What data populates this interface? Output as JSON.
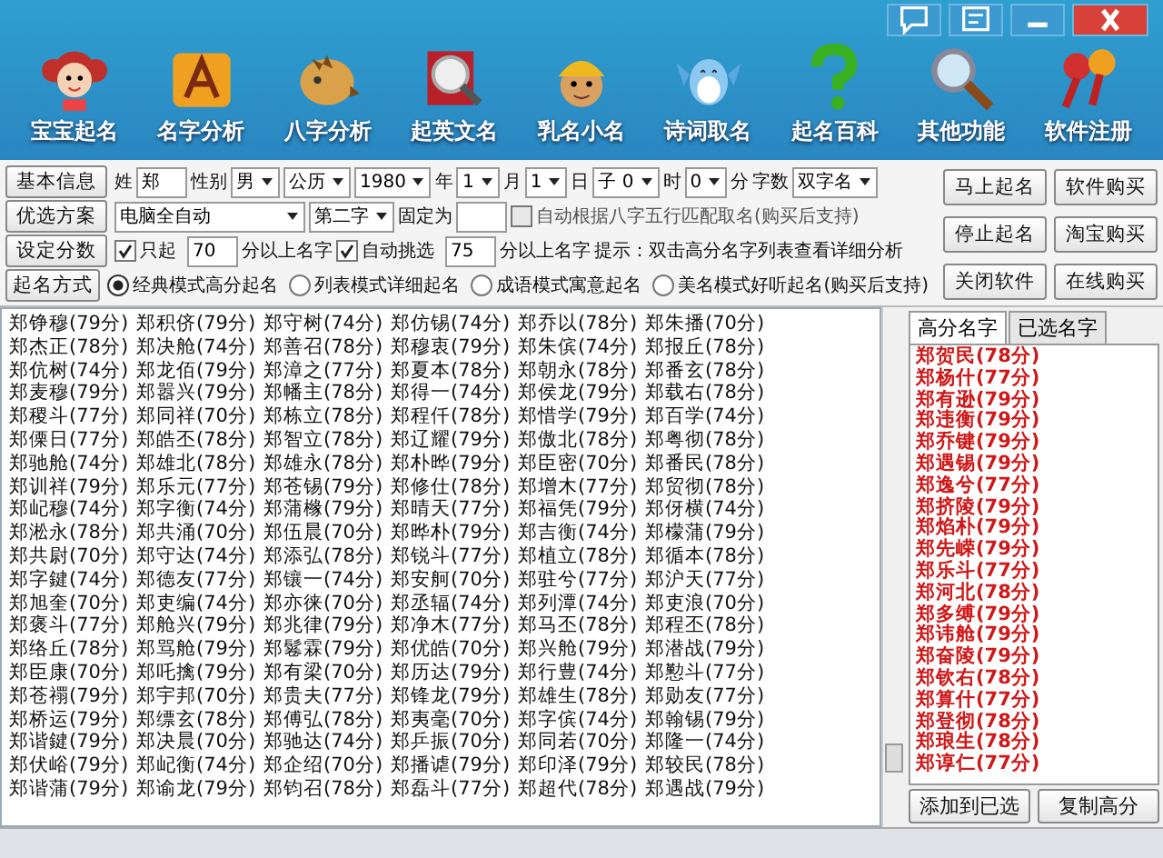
{
  "toolbar": [
    {
      "label": "宝宝起名"
    },
    {
      "label": "名字分析"
    },
    {
      "label": "八字分析"
    },
    {
      "label": "起英文名"
    },
    {
      "label": "乳名小名"
    },
    {
      "label": "诗词取名"
    },
    {
      "label": "起名百科"
    },
    {
      "label": "其他功能"
    },
    {
      "label": "软件注册"
    }
  ],
  "form_rows": [
    [
      {
        "kind": "button",
        "text": "基本信息"
      },
      {
        "kind": "label",
        "text": "姓"
      },
      {
        "kind": "input",
        "value": "郑"
      },
      {
        "kind": "label",
        "text": "性别"
      },
      {
        "kind": "select",
        "value": "男"
      },
      {
        "kind": "select",
        "value": "公历"
      },
      {
        "kind": "select",
        "value": "1980"
      },
      {
        "kind": "label",
        "text": "年"
      },
      {
        "kind": "select",
        "value": "1"
      },
      {
        "kind": "label",
        "text": "月"
      },
      {
        "kind": "select",
        "value": "1"
      },
      {
        "kind": "label",
        "text": "日"
      },
      {
        "kind": "select",
        "value": "子 0"
      },
      {
        "kind": "label",
        "text": "时"
      },
      {
        "kind": "select",
        "value": "0"
      },
      {
        "kind": "label",
        "text": "分"
      },
      {
        "kind": "label",
        "text": "字数"
      },
      {
        "kind": "select",
        "value": "双字名"
      }
    ],
    [
      {
        "kind": "button",
        "text": "优选方案"
      },
      {
        "kind": "select",
        "value": "电脑全自动"
      },
      {
        "kind": "select",
        "value": "第二字"
      },
      {
        "kind": "label",
        "text": "固定为"
      },
      {
        "kind": "input"
      },
      {
        "kind": "checkbox",
        "text": "自动根据八字五行匹配取名(购买后支持)",
        "checked": false,
        "disabled": true
      }
    ],
    [
      {
        "kind": "button",
        "text": "设定分数"
      },
      {
        "kind": "checkbox",
        "text": "只起",
        "checked": true,
        "disabled": false
      },
      {
        "kind": "input",
        "value": "70"
      },
      {
        "kind": "label",
        "text": "分以上名字"
      },
      {
        "kind": "checkbox",
        "text": "自动挑选",
        "checked": true,
        "disabled": false
      },
      {
        "kind": "input",
        "value": "75"
      },
      {
        "kind": "label",
        "text": "分以上名字"
      },
      {
        "kind": "label",
        "text": "提示：双击高分名字列表查看详细分析"
      }
    ],
    [
      {
        "kind": "button",
        "text": "起名方式"
      },
      {
        "kind": "radio",
        "text": "经典模式高分起名",
        "selected": true
      },
      {
        "kind": "radio",
        "text": "列表模式详细起名",
        "selected": false
      },
      {
        "kind": "radio",
        "text": "成语模式寓意起名",
        "selected": false
      },
      {
        "kind": "radio",
        "text": "美名模式好听起名(购买后支持)",
        "selected": false
      }
    ]
  ],
  "side_buttons": [
    "马上起名",
    "软件购买",
    "停止起名",
    "淘宝购买",
    "关闭软件",
    "在线购买"
  ],
  "name_columns": [
    [
      "郑铮穆(79分)",
      "郑杰正(78分)",
      "郑伉树(74分)",
      "郑麦穆(79分)",
      "郑稷斗(77分)",
      "郑傈日(77分)",
      "郑驰舱(74分)",
      "郑训祥(79分)",
      "郑屺穆(74分)",
      "郑淞永(78分)",
      "郑共尉(70分)",
      "郑字鍵(74分)",
      "郑旭奎(70分)",
      "郑褒斗(77分)",
      "郑络丘(78分)",
      "郑臣康(70分)",
      "郑苍禤(79分)",
      "郑桥运(79分)",
      "郑谐鍵(79分)",
      "郑伏峪(79分)",
      "郑谐蒲(79分)"
    ],
    [
      "郑积侪(79分)",
      "郑决舱(74分)",
      "郑龙佰(79分)",
      "郑嚣兴(79分)",
      "郑同祥(70分)",
      "郑皓丕(78分)",
      "郑雄北(78分)",
      "郑乐元(77分)",
      "郑字衡(74分)",
      "郑共涌(70分)",
      "郑守达(74分)",
      "郑德友(77分)",
      "郑吏编(74分)",
      "郑舱兴(79分)",
      "郑骂舱(79分)",
      "郑吒擒(79分)",
      "郑宇邦(70分)",
      "郑缥玄(78分)",
      "郑决晨(70分)",
      "郑屺衡(74分)",
      "郑谕龙(79分)"
    ],
    [
      "郑守树(74分)",
      "郑善召(78分)",
      "郑漳之(77分)",
      "郑幡主(78分)",
      "郑栋立(78分)",
      "郑智立(78分)",
      "郑雄永(78分)",
      "郑苍锡(79分)",
      "郑蒲橼(79分)",
      "郑伍晨(70分)",
      "郑添弘(78分)",
      "郑镶一(74分)",
      "郑亦徕(70分)",
      "郑兆律(79分)",
      "郑鬈霖(79分)",
      "郑有梁(70分)",
      "郑贵夫(77分)",
      "郑傅弘(78分)",
      "郑驰达(74分)",
      "郑企绍(70分)",
      "郑钧召(78分)"
    ],
    [
      "郑仿锡(74分)",
      "郑穆衷(79分)",
      "郑夏本(78分)",
      "郑得一(74分)",
      "郑程仟(78分)",
      "郑辽耀(79分)",
      "郑朴晔(79分)",
      "郑修仕(78分)",
      "郑晴天(77分)",
      "郑晔朴(79分)",
      "郑锐斗(77分)",
      "郑安舸(70分)",
      "郑丞辐(74分)",
      "郑净木(77分)",
      "郑优皓(70分)",
      "郑历达(79分)",
      "郑锋龙(79分)",
      "郑夷毫(70分)",
      "郑乒振(70分)",
      "郑播谑(79分)",
      "郑磊斗(77分)"
    ],
    [
      "郑乔以(78分)",
      "郑朱傧(74分)",
      "郑朝永(78分)",
      "郑侯龙(79分)",
      "郑惜学(79分)",
      "郑傲北(78分)",
      "郑臣密(70分)",
      "郑增木(77分)",
      "郑福凭(79分)",
      "郑吉衡(74分)",
      "郑植立(78分)",
      "郑驻兮(77分)",
      "郑列潭(74分)",
      "郑马丕(78分)",
      "郑兴舱(79分)",
      "郑行豊(74分)",
      "郑雄生(78分)",
      "郑字傧(74分)",
      "郑同若(70分)",
      "郑印泽(79分)",
      "郑超代(78分)"
    ],
    [
      "郑朱播(70分)",
      "郑报丘(78分)",
      "郑番玄(78分)",
      "郑载右(78分)",
      "郑百学(74分)",
      "郑粤彻(78分)",
      "郑番民(78分)",
      "郑贸彻(78分)",
      "郑伢横(74分)",
      "郑檬蒲(79分)",
      "郑循本(78分)",
      "郑沪天(77分)",
      "郑吏浪(70分)",
      "郑程丕(78分)",
      "郑潜战(79分)",
      "郑懃斗(77分)",
      "郑勋友(77分)",
      "郑翰锡(79分)",
      "郑隆一(74分)",
      "郑较民(78分)",
      "郑遇战(79分)"
    ]
  ],
  "tabs": [
    {
      "label": "高分名字",
      "selected": true
    },
    {
      "label": "已选名字",
      "selected": false
    }
  ],
  "top_names": [
    "郑贺民(78分)",
    "郑杨什(77分)",
    "郑有逊(79分)",
    "郑违衡(79分)",
    "郑乔键(79分)",
    "郑遇锡(79分)",
    "郑逸兮(77分)",
    "郑挤陵(79分)",
    "郑焰朴(79分)",
    "郑先嵘(79分)",
    "郑乐斗(77分)",
    "郑河北(78分)",
    "郑多缚(79分)",
    "郑讳舱(79分)",
    "郑奋陵(79分)",
    "郑钦右(78分)",
    "郑算什(77分)",
    "郑登彻(78分)",
    "郑琅生(78分)",
    "郑谆仁(77分)"
  ],
  "panel_buttons": [
    "添加到已选",
    "复制高分"
  ]
}
